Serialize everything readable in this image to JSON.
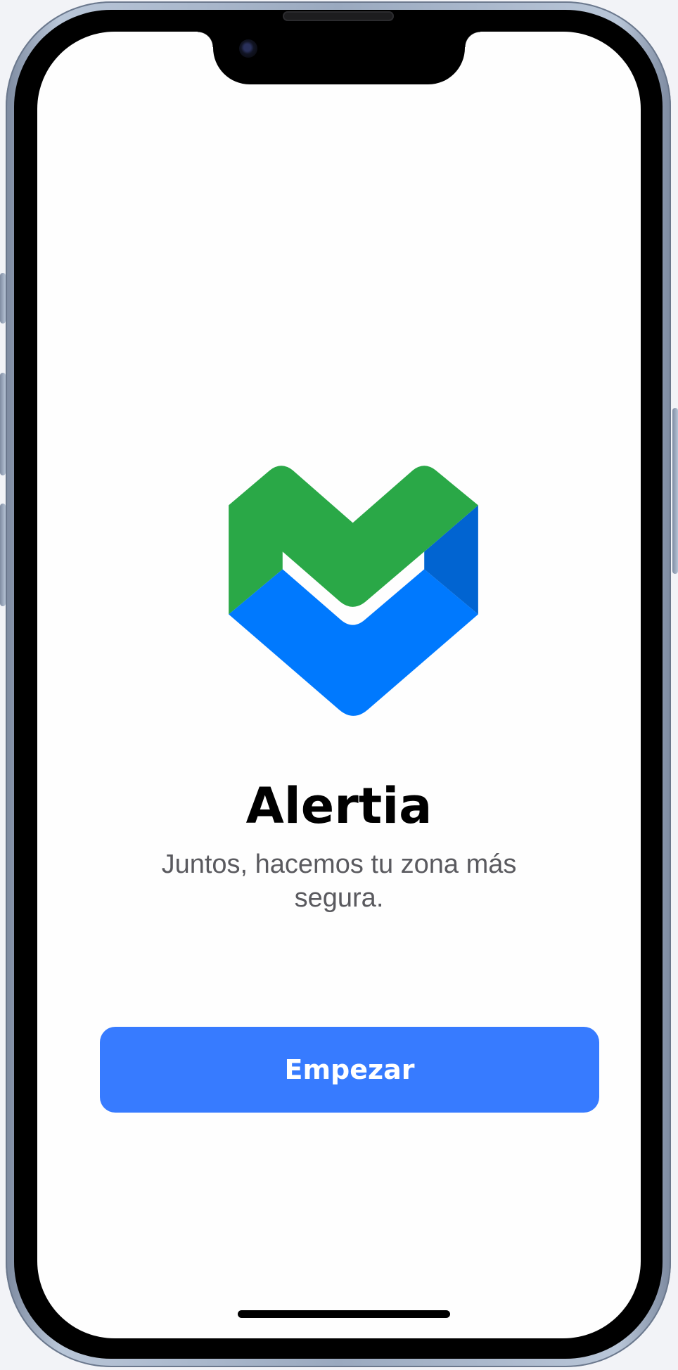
{
  "app": {
    "name": "Alertia",
    "tagline": "Juntos, hacemos tu zona más segura.",
    "logo_icon": "alertia-heart-logo-icon"
  },
  "actions": {
    "start_label": "Empezar"
  },
  "colors": {
    "brand_green": "#2aa847",
    "brand_blue": "#0079fe",
    "brand_blue_dark": "#0164d1",
    "button_blue": "#377bff",
    "title_text": "#000000",
    "tagline_text": "#5a5a5f"
  }
}
